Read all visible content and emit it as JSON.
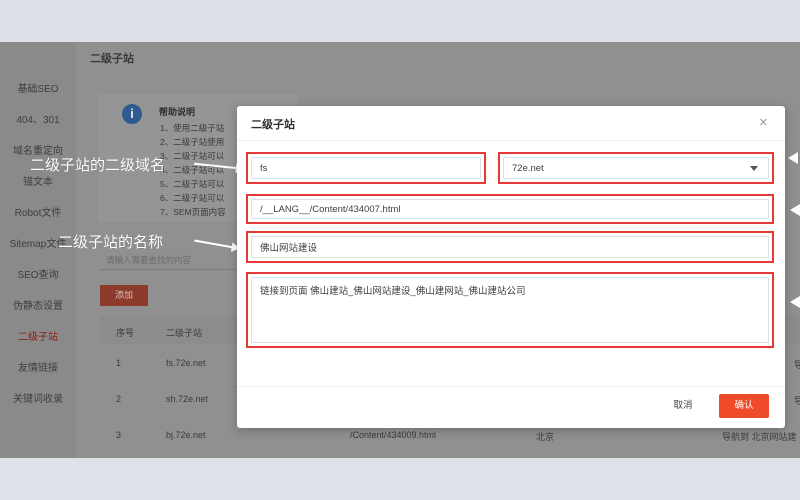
{
  "sidebar": {
    "items": [
      "基础SEO",
      "404、301",
      "域名重定向",
      "锚文本",
      "Robot文件",
      "Sitemap文件",
      "SEO查询",
      "伪静态设置",
      "二级子站",
      "友情链接",
      "关键词收录"
    ],
    "active_index": 8
  },
  "main": {
    "title": "二级子站",
    "help_title": "帮助说明",
    "help_lines": [
      "1、使用二级子站",
      "2、二级子站使用",
      "3、二级子站可以",
      "4、二级子站可以",
      "5、二级子站可以",
      "6、二级子站可以",
      "7、SEM页面内容"
    ],
    "search_placeholder": "请输入需要查找的内容",
    "add_label": "添加",
    "table": {
      "headers": [
        "序号",
        "二级子站"
      ],
      "rows": [
        {
          "index": "1",
          "subdomain": "fs.72e.net",
          "path": "",
          "city": "",
          "desc": "导"
        },
        {
          "index": "2",
          "subdomain": "sh.72e.net",
          "path": "",
          "city": "",
          "desc": "导"
        },
        {
          "index": "3",
          "subdomain": "bj.72e.net",
          "path": "/Content/434009.html",
          "city": "北京",
          "desc": "导航到 北京网站建"
        }
      ]
    }
  },
  "annotations": {
    "subdomain": "二级子站的二级域名",
    "name": "二级子站的名称"
  },
  "modal": {
    "title": "二级子站",
    "close_glyph": "×",
    "subdomain_value": "fs",
    "domain_value": "72e.net",
    "url_value": "/__LANG__/Content/434007.html",
    "name_value": "佛山网站建设",
    "desc_value": "链接到页面 佛山建站_佛山网站建设_佛山建网站_佛山建站公司",
    "cancel_label": "取消",
    "confirm_label": "确认"
  },
  "colors": {
    "accent": "#ef4a2a",
    "highlight_border": "#e53935"
  }
}
